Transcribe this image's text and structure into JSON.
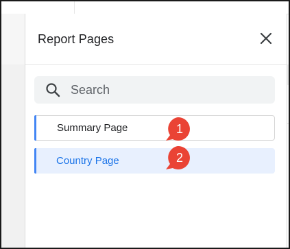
{
  "panel": {
    "title": "Report Pages",
    "close_icon": "close-icon"
  },
  "search": {
    "icon": "search-icon",
    "placeholder": "Search"
  },
  "pages": [
    {
      "label": "Summary Page",
      "selected": false
    },
    {
      "label": "Country Page",
      "selected": true
    }
  ],
  "badges": [
    "1",
    "2"
  ],
  "colors": {
    "accent": "#4285f4",
    "selected_bg": "#e8f0fe",
    "selected_text": "#1a73e8",
    "badge": "#ea4335",
    "search_bg": "#f1f3f4"
  }
}
